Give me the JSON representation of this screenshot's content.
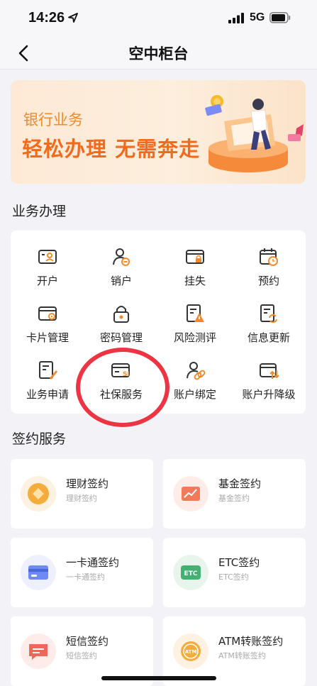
{
  "status_bar": {
    "time": "14:26",
    "network": "5G"
  },
  "nav": {
    "title": "空中柜台"
  },
  "banner": {
    "subtitle": "银行业务",
    "headline": "轻松办理 无需奔走"
  },
  "business_section": {
    "title": "业务办理",
    "items": [
      {
        "label": "开户",
        "icon": "id-card-icon"
      },
      {
        "label": "销户",
        "icon": "user-minus-icon"
      },
      {
        "label": "挂失",
        "icon": "card-lock-icon"
      },
      {
        "label": "预约",
        "icon": "calendar-clock-icon"
      },
      {
        "label": "卡片管理",
        "icon": "card-settings-icon"
      },
      {
        "label": "密码管理",
        "icon": "padlock-icon"
      },
      {
        "label": "风险测评",
        "icon": "document-warning-icon"
      },
      {
        "label": "信息更新",
        "icon": "document-refresh-icon"
      },
      {
        "label": "业务申请",
        "icon": "document-edit-icon"
      },
      {
        "label": "社保服务",
        "icon": "social-security-card-icon"
      },
      {
        "label": "账户绑定",
        "icon": "user-link-icon"
      },
      {
        "label": "账户升降级",
        "icon": "card-updown-icon"
      }
    ]
  },
  "contract_section": {
    "title": "签约服务",
    "items": [
      {
        "title": "理财签约",
        "subtitle": "理财签约",
        "icon": "wealth-icon",
        "color": "#f2a73b"
      },
      {
        "title": "基金签约",
        "subtitle": "基金签约",
        "icon": "fund-chart-icon",
        "color": "#f07a5a"
      },
      {
        "title": "一卡通签约",
        "subtitle": "一卡通签约",
        "icon": "bank-card-icon",
        "color": "#5b7cf0"
      },
      {
        "title": "ETC签约",
        "subtitle": "ETC签约",
        "icon": "etc-icon",
        "color": "#3fae6a"
      },
      {
        "title": "短信签约",
        "subtitle": "短信签约",
        "icon": "message-icon",
        "color": "#f0665a"
      },
      {
        "title": "ATM转账签约",
        "subtitle": "ATM转账签约",
        "icon": "atm-icon",
        "color": "#f2a73b"
      }
    ]
  },
  "colors": {
    "accent": "#f26b1d",
    "highlight": "#ee3342",
    "icon_orange": "#f08a2b"
  }
}
